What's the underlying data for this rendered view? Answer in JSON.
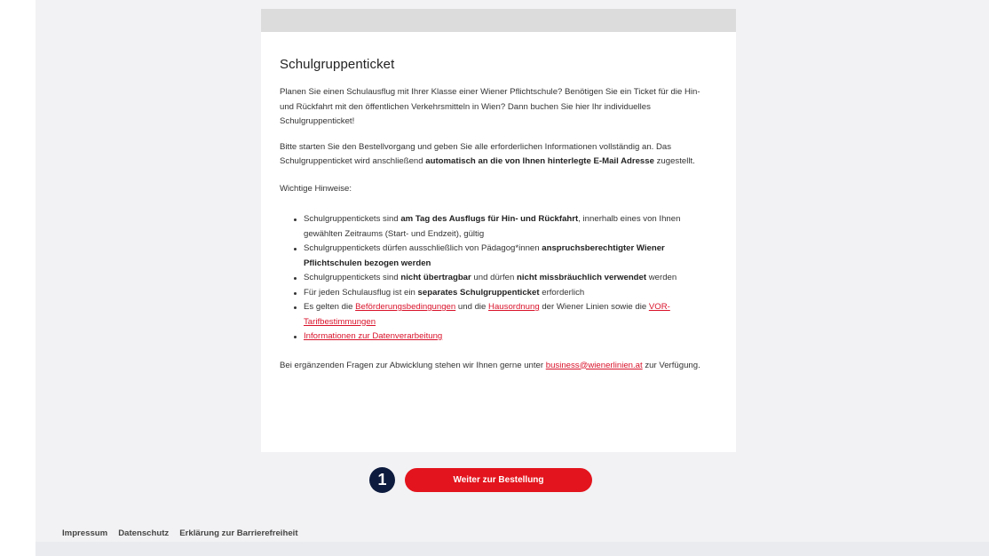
{
  "card": {
    "title": "Schulgruppenticket",
    "intro": "Planen Sie einen Schulausflug mit Ihrer Klasse einer Wiener Pflichtschule? Benötigen Sie ein Ticket für die Hin- und Rückfahrt mit den öffentlichen Verkehrsmitteln in Wien? Dann buchen Sie hier Ihr individuelles Schulgruppenticket!",
    "start_text_1": "Bitte starten Sie den Bestellvorgang und geben Sie alle erforderlichen Informationen vollständig an. Das Schulgruppenticket wird anschließend ",
    "start_text_bold": "automatisch an die von Ihnen hinterlegte E-Mail Adresse",
    "start_text_2": " zugestellt.",
    "hints_heading": "Wichtige Hinweise:",
    "hints": {
      "h1_a": "Schulgruppentickets sind ",
      "h1_b": "am Tag des Ausflugs für Hin- und Rückfahrt",
      "h1_c": ", innerhalb eines von Ihnen gewählten Zeitraums (Start- und Endzeit), gültig",
      "h2_a": "Schulgruppentickets dürfen ausschließlich von Pädagog*innen ",
      "h2_b": "anspruchsberechtigter Wiener Pflichtschulen bezogen werden",
      "h3_a": "Schulgruppentickets sind ",
      "h3_b": "nicht übertragbar",
      "h3_c": " und dürfen ",
      "h3_d": "nicht missbräuchlich verwendet",
      "h3_e": " werden",
      "h4_a": "Für jeden Schulausflug ist ein ",
      "h4_b": "separates Schulgruppenticket",
      "h4_c": " erforderlich",
      "h5_a": "Es gelten die ",
      "h5_link1": "Beförderungsbedingungen",
      "h5_b": " und die ",
      "h5_link2": "Hausordnung",
      "h5_c": " der Wiener Linien sowie die ",
      "h5_link3": "VOR-Tarifbestimmungen",
      "h6_link": "Informationen zur Datenverarbeitung"
    },
    "contact_a": "Bei ergänzenden Fragen zur Abwicklung stehen wir Ihnen gerne unter ",
    "contact_email": "business@wienerlinien.at",
    "contact_b": " zur Verfügung."
  },
  "step_badge": "1",
  "order_button": "Weiter zur Bestellung",
  "footer": {
    "links": [
      "Impressum",
      "Datenschutz",
      "Erklärung zur Barrierefreiheit"
    ]
  },
  "colors": {
    "accent": "#e3141d",
    "badge": "#0d1b3e",
    "link": "#d9122a"
  }
}
